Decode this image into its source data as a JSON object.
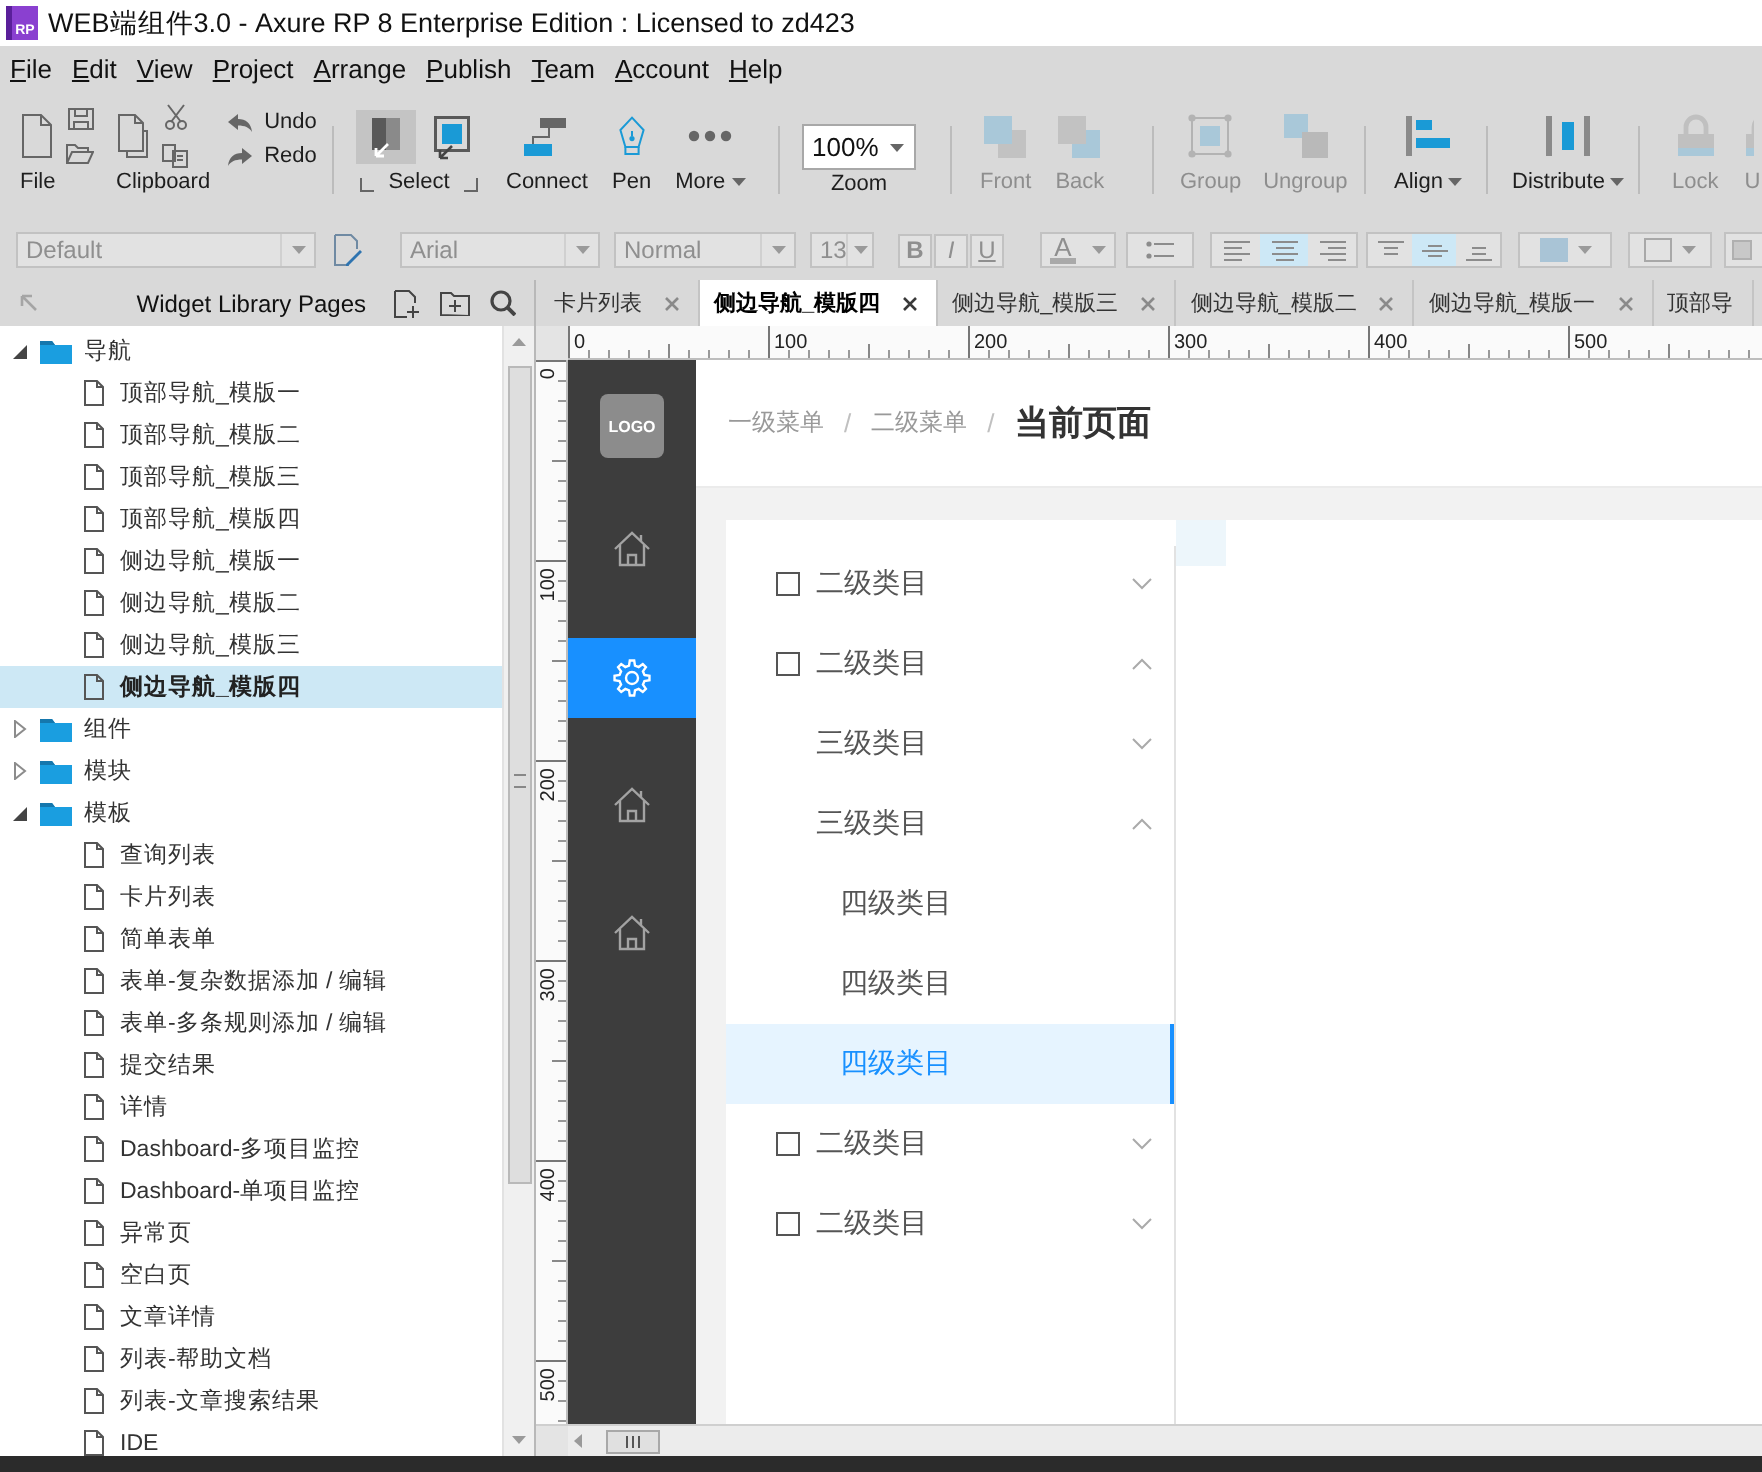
{
  "window": {
    "app_icon": "RP",
    "title": "WEB端组件3.0 - Axure RP 8 Enterprise Edition : Licensed to zd423"
  },
  "menu_bar": [
    "File",
    "Edit",
    "View",
    "Project",
    "Arrange",
    "Publish",
    "Team",
    "Account",
    "Help"
  ],
  "toolbar": {
    "groups": [
      {
        "items": [
          {
            "kind": "file",
            "label": "File",
            "disabled": false
          },
          {
            "kind": "clipboard",
            "label": "Clipboard",
            "disabled": false
          },
          {
            "kind": "history",
            "undo": "Undo",
            "redo": "Redo",
            "disabled": false
          }
        ]
      },
      {
        "items": [
          {
            "kind": "select",
            "label": "Select",
            "disabled": false,
            "modes": [
              {
                "selected": true
              },
              {
                "selected": false
              }
            ]
          },
          {
            "kind": "connect",
            "label": "Connect",
            "disabled": false,
            "dropdown": false
          },
          {
            "kind": "pen",
            "label": "Pen",
            "disabled": false,
            "dropdown": false
          },
          {
            "kind": "more",
            "label": "More",
            "disabled": false,
            "dropdown": true
          }
        ]
      },
      {
        "items": [
          {
            "kind": "zoom",
            "value": "100%",
            "label": "Zoom",
            "disabled": false
          }
        ]
      },
      {
        "items": [
          {
            "kind": "front",
            "label": "Front",
            "disabled": true,
            "dropdown": false
          },
          {
            "kind": "back",
            "label": "Back",
            "disabled": true,
            "dropdown": false
          }
        ]
      },
      {
        "items": [
          {
            "kind": "group",
            "label": "Group",
            "disabled": true,
            "dropdown": false
          },
          {
            "kind": "ungroup",
            "label": "Ungroup",
            "disabled": true,
            "dropdown": false
          }
        ]
      },
      {
        "items": [
          {
            "kind": "align",
            "label": "Align",
            "disabled": false,
            "dropdown": true
          }
        ]
      },
      {
        "items": [
          {
            "kind": "distribute",
            "label": "Distribute",
            "disabled": false,
            "dropdown": true
          }
        ]
      },
      {
        "items": [
          {
            "kind": "lock",
            "label": "Lock",
            "disabled": true,
            "dropdown": false
          },
          {
            "kind": "unlock",
            "label": "U",
            "disabled": true,
            "dropdown": false
          }
        ]
      }
    ]
  },
  "format_bar": {
    "disabled": true,
    "style": "Default",
    "font": "Arial",
    "weight": "Normal",
    "size": "13",
    "text_styles": [
      "B",
      "I",
      "U"
    ],
    "font_color_button": "A",
    "text_align": [
      {
        "selected": false
      },
      {
        "selected": true
      },
      {
        "selected": false
      }
    ],
    "vertical_align": [
      {
        "selected": false
      },
      {
        "selected": true
      },
      {
        "selected": false
      }
    ]
  },
  "pages_panel": {
    "title": "Widget Library Pages",
    "tree": [
      {
        "kind": "folder",
        "label": "导航",
        "expanded": true,
        "selected": false,
        "children": [
          {
            "kind": "page",
            "label": "顶部导航_模版一",
            "selected": false
          },
          {
            "kind": "page",
            "label": "顶部导航_模版二",
            "selected": false
          },
          {
            "kind": "page",
            "label": "顶部导航_模版三",
            "selected": false
          },
          {
            "kind": "page",
            "label": "顶部导航_模版四",
            "selected": false
          },
          {
            "kind": "page",
            "label": "侧边导航_模版一",
            "selected": false
          },
          {
            "kind": "page",
            "label": "侧边导航_模版二",
            "selected": false
          },
          {
            "kind": "page",
            "label": "侧边导航_模版三",
            "selected": false
          },
          {
            "kind": "page",
            "label": "侧边导航_模版四",
            "selected": true
          }
        ]
      },
      {
        "kind": "folder",
        "label": "组件",
        "expanded": false,
        "selected": false
      },
      {
        "kind": "folder",
        "label": "模块",
        "expanded": false,
        "selected": false
      },
      {
        "kind": "folder",
        "label": "模板",
        "expanded": true,
        "selected": false,
        "children": [
          {
            "kind": "page",
            "label": "查询列表",
            "selected": false
          },
          {
            "kind": "page",
            "label": "卡片列表",
            "selected": false
          },
          {
            "kind": "page",
            "label": "简单表单",
            "selected": false
          },
          {
            "kind": "page",
            "label": "表单-复杂数据添加 / 编辑",
            "selected": false
          },
          {
            "kind": "page",
            "label": "表单-多条规则添加 / 编辑",
            "selected": false
          },
          {
            "kind": "page",
            "label": "提交结果",
            "selected": false
          },
          {
            "kind": "page",
            "label": "详情",
            "selected": false
          },
          {
            "kind": "page",
            "label": "Dashboard-多项目监控",
            "selected": false
          },
          {
            "kind": "page",
            "label": "Dashboard-单项目监控",
            "selected": false
          },
          {
            "kind": "page",
            "label": "异常页",
            "selected": false
          },
          {
            "kind": "page",
            "label": "空白页",
            "selected": false
          },
          {
            "kind": "page",
            "label": "文章详情",
            "selected": false
          },
          {
            "kind": "page",
            "label": "列表-帮助文档",
            "selected": false
          },
          {
            "kind": "page",
            "label": "列表-文章搜索结果",
            "selected": false
          },
          {
            "kind": "page",
            "label": "IDE",
            "selected": false
          }
        ]
      }
    ]
  },
  "tabs": [
    {
      "label": "卡片列表",
      "selected": false,
      "closable": true
    },
    {
      "label": "侧边导航_模版四",
      "selected": true,
      "closable": true
    },
    {
      "label": "侧边导航_模版三",
      "selected": false,
      "closable": true
    },
    {
      "label": "侧边导航_模版二",
      "selected": false,
      "closable": true
    },
    {
      "label": "侧边导航_模版一",
      "selected": false,
      "closable": true
    },
    {
      "label": "顶部导",
      "selected": false,
      "closable": false
    }
  ],
  "rulers": {
    "horizontal": [
      "0",
      "100",
      "200",
      "300",
      "400",
      "500"
    ],
    "vertical": [
      "0",
      "100",
      "200",
      "300",
      "400",
      "500"
    ]
  },
  "canvas": {
    "sidebar": {
      "logo": "LOGO",
      "items": [
        {
          "kind": "home",
          "selected": false
        },
        {
          "kind": "settings",
          "selected": true
        },
        {
          "kind": "home",
          "selected": false
        },
        {
          "kind": "home",
          "selected": false
        }
      ]
    },
    "breadcrumb": [
      {
        "kind": "link",
        "text": "一级菜单"
      },
      {
        "kind": "separator",
        "text": "/"
      },
      {
        "kind": "link",
        "text": "二级菜单"
      },
      {
        "kind": "separator",
        "text": "/"
      },
      {
        "kind": "current",
        "text": "当前页面"
      }
    ],
    "menu": [
      {
        "label": "二级类目",
        "expanded": false,
        "selected": false
      },
      {
        "label": "二级类目",
        "expanded": true,
        "selected": false,
        "children": [
          {
            "label": "三级类目",
            "expanded": false,
            "selected": false
          },
          {
            "label": "三级类目",
            "expanded": true,
            "selected": false,
            "children": [
              {
                "label": "四级类目",
                "selected": false
              },
              {
                "label": "四级类目",
                "selected": false
              },
              {
                "label": "四级类目",
                "selected": true
              }
            ]
          }
        ]
      },
      {
        "label": "二级类目",
        "expanded": false,
        "selected": false
      },
      {
        "label": "二级类目",
        "expanded": false,
        "selected": false
      }
    ]
  }
}
